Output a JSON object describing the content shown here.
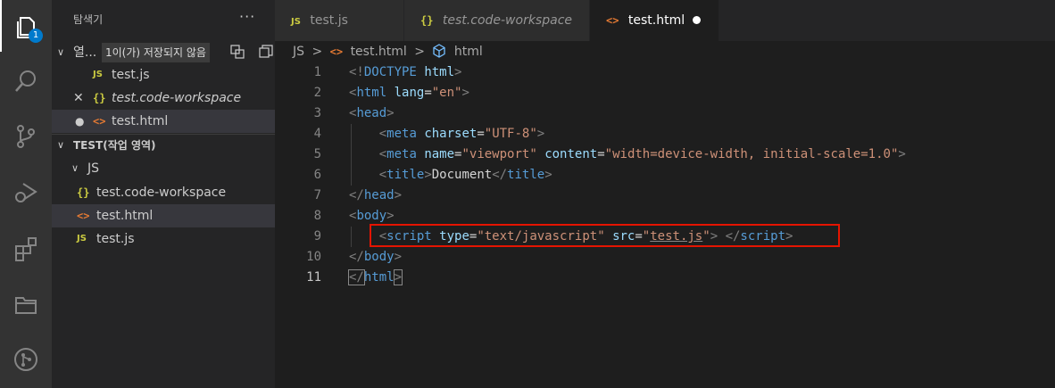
{
  "activity_bar": {
    "explorer_badge": "1"
  },
  "sidebar": {
    "title": "탐색기",
    "more": "···",
    "open_editors": {
      "label": "열...",
      "tooltip": "1이(가) 저장되지 않음",
      "files": [
        {
          "icon": "JS",
          "name": "test.js"
        },
        {
          "icon": "{}",
          "name": "test.code-workspace"
        },
        {
          "icon": "<>",
          "name": "test.html"
        }
      ]
    },
    "workspace": {
      "title": "TEST(작업 영역)",
      "folder": "JS",
      "files": [
        {
          "icon": "{}",
          "name": "test.code-workspace"
        },
        {
          "icon": "<>",
          "name": "test.html"
        },
        {
          "icon": "JS",
          "name": "test.js"
        }
      ]
    }
  },
  "tabs": [
    {
      "icon": "JS",
      "label": "test.js"
    },
    {
      "icon": "{}",
      "label": "test.code-workspace"
    },
    {
      "icon": "<>",
      "label": "test.html"
    }
  ],
  "breadcrumb": {
    "folder": "JS",
    "sep": ">",
    "file_icon": "<>",
    "file": "test.html",
    "symbol": "html"
  },
  "editor": {
    "line_numbers": [
      "1",
      "2",
      "3",
      "4",
      "5",
      "6",
      "7",
      "8",
      "9",
      "10",
      "11"
    ],
    "lines": {
      "l1": {
        "open": "<!",
        "tag": "DOCTYPE",
        "sp": " ",
        "attr": "html",
        "close": ">"
      },
      "l2": {
        "open": "<",
        "tag": "html",
        "sp": " ",
        "attr": "lang",
        "eq": "=",
        "val": "\"en\"",
        "close": ">"
      },
      "l3": {
        "open": "<",
        "tag": "head",
        "close": ">"
      },
      "l4": {
        "indent": "    ",
        "open": "<",
        "tag": "meta",
        "sp": " ",
        "attr": "charset",
        "eq": "=",
        "val": "\"UTF-8\"",
        "close": ">"
      },
      "l5": {
        "indent": "    ",
        "open": "<",
        "tag": "meta",
        "sp": " ",
        "attr1": "name",
        "eq1": "=",
        "val1": "\"viewport\"",
        "sp2": " ",
        "attr2": "content",
        "eq2": "=",
        "val2": "\"width=device-width, initial-scale=1.0\"",
        "close": ">"
      },
      "l6": {
        "indent": "    ",
        "open": "<",
        "tag": "title",
        "close": ">",
        "text": "Document",
        "open2": "</",
        "tag2": "title",
        "close2": ">"
      },
      "l7": {
        "open": "</",
        "tag": "head",
        "close": ">"
      },
      "l8": {
        "open": "<",
        "tag": "body",
        "close": ">"
      },
      "l9": {
        "indent": "    ",
        "open": "<",
        "tag": "script",
        "sp": " ",
        "attr1": "type",
        "eq1": "=",
        "val1": "\"text/javascript\"",
        "sp2": " ",
        "attr2": "src",
        "eq2": "=",
        "q1": "\"",
        "val2": "test.js",
        "q2": "\"",
        "close": ">",
        "sp3": " ",
        "open2": "</",
        "tag2": "script",
        "close2": ">"
      },
      "l10": {
        "open": "</",
        "tag": "body",
        "close": ">"
      },
      "l11": {
        "open": "</",
        "tag": "html",
        "close": ">"
      }
    }
  }
}
